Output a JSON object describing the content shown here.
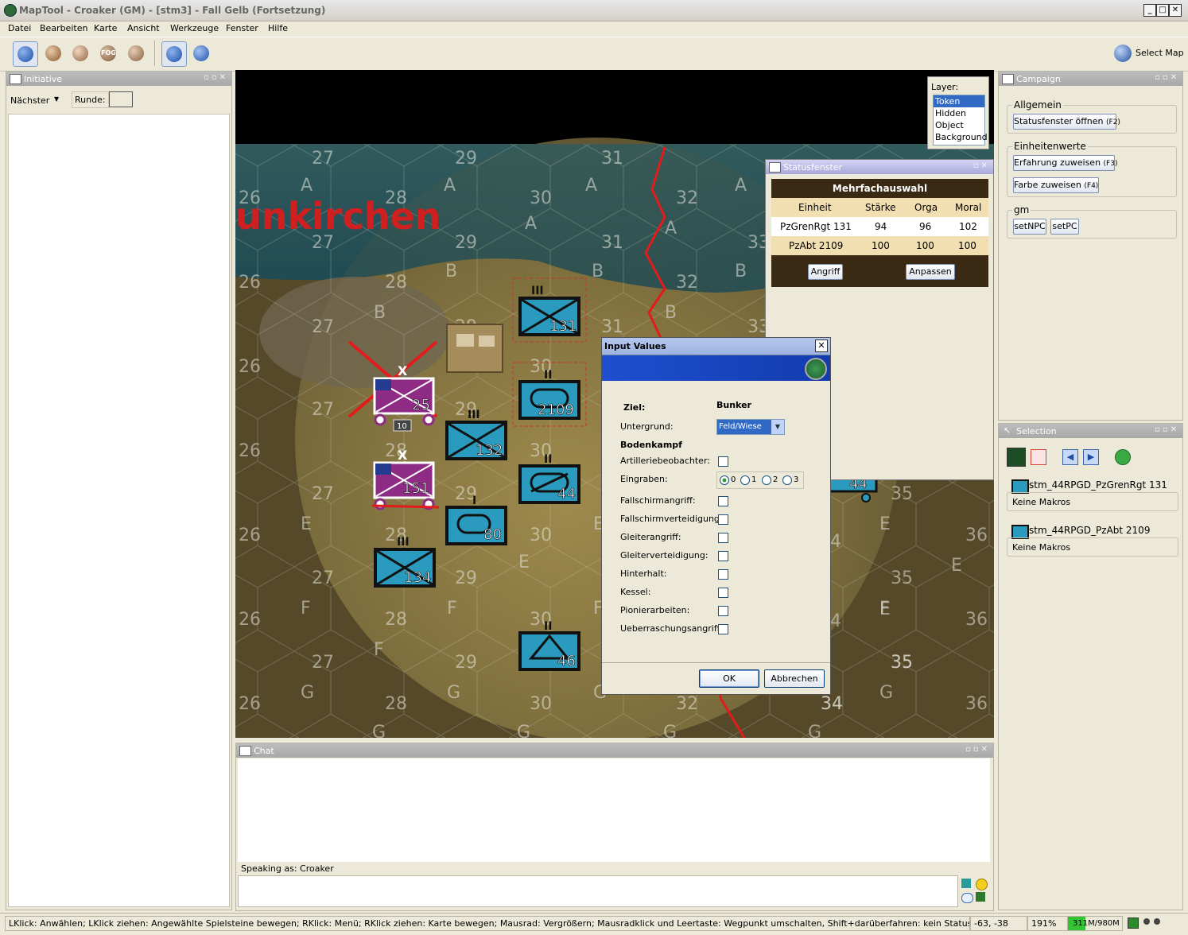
{
  "window": {
    "title": "MapTool - Croaker (GM) - [stm3] - Fall Gelb (Fortsetzung)"
  },
  "menu": [
    "Datei",
    "Bearbeiten",
    "Karte",
    "Ansicht",
    "Werkzeuge",
    "Fenster",
    "Hilfe"
  ],
  "toolbar": {
    "fog_label": "FOG",
    "select_map": "Select Map"
  },
  "initiative": {
    "title": "Initiative",
    "next_label": "Nächster",
    "round_label": "Runde:"
  },
  "map": {
    "city_label": "unkirchen",
    "hex_labels": [
      {
        "t": "27",
        "c": "a"
      },
      {
        "t": "29",
        "c": "b"
      },
      {
        "t": "31",
        "c": "c"
      },
      {
        "t": "A",
        "c": "d"
      },
      {
        "t": "A",
        "c": "e"
      },
      {
        "t": "A",
        "c": "f"
      },
      {
        "t": "26",
        "c": "g"
      },
      {
        "t": "28",
        "c": "h"
      },
      {
        "t": "30",
        "c": "i"
      },
      {
        "t": "32",
        "c": "j"
      },
      {
        "t": "A",
        "c": "k"
      },
      {
        "t": "A",
        "c": "l"
      },
      {
        "t": "A",
        "c": "m"
      },
      {
        "t": "27",
        "c": "n"
      },
      {
        "t": "29",
        "c": "o"
      },
      {
        "t": "31",
        "c": "p"
      },
      {
        "t": "33",
        "c": "q"
      },
      {
        "t": "26",
        "c": "r"
      },
      {
        "t": "28",
        "c": "s"
      },
      {
        "t": "32",
        "c": "t"
      },
      {
        "t": "B",
        "c": "u"
      },
      {
        "t": "B",
        "c": "v"
      },
      {
        "t": "B",
        "c": "w"
      },
      {
        "t": "B",
        "c": "x"
      },
      {
        "t": "27",
        "c": "y"
      },
      {
        "t": "29",
        "c": "z"
      },
      {
        "t": "31",
        "c": "aa"
      },
      {
        "t": "33",
        "c": "ab"
      },
      {
        "t": "B",
        "c": "ac"
      },
      {
        "t": "26",
        "c": "ad"
      },
      {
        "t": "30",
        "c": "ae"
      },
      {
        "t": "27",
        "c": "af"
      },
      {
        "t": "29",
        "c": "ag"
      },
      {
        "t": "26",
        "c": "ah"
      },
      {
        "t": "28",
        "c": "ai"
      },
      {
        "t": "30",
        "c": "aj"
      },
      {
        "t": "35",
        "c": "ak"
      },
      {
        "t": "27",
        "c": "al"
      },
      {
        "t": "29",
        "c": "am"
      },
      {
        "t": "26",
        "c": "an"
      },
      {
        "t": "E",
        "c": "ao"
      },
      {
        "t": "28",
        "c": "ap"
      },
      {
        "t": "30",
        "c": "aq"
      },
      {
        "t": "E",
        "c": "ar"
      },
      {
        "t": "E",
        "c": "as"
      },
      {
        "t": "36",
        "c": "at"
      },
      {
        "t": "E",
        "c": "au"
      },
      {
        "t": "27",
        "c": "av"
      },
      {
        "t": "29",
        "c": "aw"
      },
      {
        "t": "E",
        "c": "ax"
      },
      {
        "t": "35",
        "c": "ay"
      },
      {
        "t": "E",
        "c": "az"
      },
      {
        "t": "26",
        "c": "ba"
      },
      {
        "t": "F",
        "c": "bb"
      },
      {
        "t": "28",
        "c": "bc"
      },
      {
        "t": "F",
        "c": "bd"
      },
      {
        "t": "30",
        "c": "be"
      },
      {
        "t": "F",
        "c": "bf"
      },
      {
        "t": "F",
        "c": "bg"
      },
      {
        "t": "36",
        "c": "bh"
      },
      {
        "t": "27",
        "c": "bi"
      },
      {
        "t": "F",
        "c": "bj"
      },
      {
        "t": "29",
        "c": "bk"
      },
      {
        "t": "35",
        "c": "bl"
      },
      {
        "t": "26",
        "c": "bm"
      },
      {
        "t": "G",
        "c": "bn"
      },
      {
        "t": "28",
        "c": "bo"
      },
      {
        "t": "G",
        "c": "bp"
      },
      {
        "t": "30",
        "c": "bq"
      },
      {
        "t": "G",
        "c": "br"
      },
      {
        "t": "32",
        "c": "bs"
      },
      {
        "t": "34",
        "c": "bt"
      },
      {
        "t": "G",
        "c": "bu"
      },
      {
        "t": "36",
        "c": "bv"
      },
      {
        "t": "G",
        "c": "bw"
      },
      {
        "t": "G",
        "c": "bx"
      },
      {
        "t": "G",
        "c": "by"
      },
      {
        "t": "G",
        "c": "bz"
      },
      {
        "t": "4",
        "c": "ca"
      },
      {
        "t": "4",
        "c": "cb"
      },
      {
        "t": "35",
        "c": "cc"
      },
      {
        "t": "34",
        "c": "cd"
      }
    ],
    "units": [
      {
        "id": "131",
        "echelon": "III",
        "kind": "mech"
      },
      {
        "id": "2109",
        "echelon": "II",
        "kind": "armor"
      },
      {
        "id": "132",
        "echelon": "III",
        "kind": "mech"
      },
      {
        "id": "44",
        "echelon": "II",
        "kind": "mech"
      },
      {
        "id": "80",
        "echelon": "I",
        "kind": "armor"
      },
      {
        "id": "134",
        "echelon": "III",
        "kind": "mech"
      },
      {
        "id": "46",
        "echelon": "II",
        "kind": "mech"
      },
      {
        "id": "25",
        "echelon": "X",
        "kind": "enemy"
      },
      {
        "id": "151",
        "echelon": "X",
        "kind": "enemy"
      },
      {
        "id": "10",
        "echelon": "",
        "kind": "marker"
      },
      {
        "id": "44",
        "echelon": "",
        "kind": "partial"
      }
    ],
    "layers": {
      "title": "Layer:",
      "items": [
        "Token",
        "Hidden",
        "Object",
        "Background"
      ],
      "selected": "Token"
    }
  },
  "statusfenster": {
    "title": "Statusfenster",
    "header": "Mehrfachauswahl",
    "columns": [
      "Einheit",
      "Stärke",
      "Orga",
      "Moral"
    ],
    "rows": [
      [
        "PzGrenRgt 131",
        "94",
        "96",
        "102"
      ],
      [
        "PzAbt 2109",
        "100",
        "100",
        "100"
      ]
    ],
    "attack_button": "Angriff",
    "adjust_button": "Anpassen"
  },
  "dialog": {
    "title": "Input Values",
    "target_label": "Ziel:",
    "target_value": "Bunker",
    "ground_label": "Untergrund:",
    "ground_value": "Feld/Wiese",
    "section": "Bodenkampf",
    "artillery": "Artilleriebeobachter:",
    "dig_in": "Eingraben:",
    "dig_options": [
      "0",
      "1",
      "2",
      "3"
    ],
    "dig_selected": "0",
    "para_attack": "Fallschirmangriff:",
    "para_defense": "Fallschirmverteidigung:",
    "glider_attack": "Gleiterangriff:",
    "glider_defense": "Gleiterverteidigung:",
    "ambush": "Hinterhalt:",
    "pocket": "Kessel:",
    "engineering": "Pionierarbeiten:",
    "surprise": "Ueberraschungsangriff:",
    "ok": "OK",
    "cancel": "Abbrechen"
  },
  "campaign": {
    "title": "Campaign",
    "general_group": "Allgemein",
    "status_btn": "Statusfenster öffnen",
    "status_key": "(F2)",
    "unit_group": "Einheitenwerte",
    "exp_btn": "Erfahrung zuweisen",
    "exp_key": "(F3)",
    "color_btn": "Farbe zuweisen",
    "color_key": "(F4)",
    "gm_group": "gm",
    "set_npc": "setNPC",
    "set_pc": "setPC"
  },
  "selection": {
    "title": "Selection",
    "items": [
      {
        "name": "stm_44RPGD_PzGrenRgt 131",
        "macros": "Keine Makros"
      },
      {
        "name": "stm_44RPGD_PzAbt 2109",
        "macros": "Keine Makros"
      }
    ]
  },
  "chat": {
    "title": "Chat",
    "speaking_as": "Speaking as: Croaker"
  },
  "statusbar": {
    "hint": "LKlick: Anwählen; LKlick ziehen: Angewählte Spielsteine bewegen; RKlick: Menü; RKlick ziehen: Karte bewegen; Mausrad: Vergrößern; Mausradklick und Leertaste: Wegpunkt umschalten, Shift+darüberfahren: kein Statusfeld",
    "coords": "-63, -38",
    "zoom": "191%",
    "memory": "311M/980M",
    "memory_fraction": 0.317
  },
  "colors": {
    "unit_fill": "#2a9bbf",
    "enemy_fill": "#8e2b84",
    "river": "#e31b1b",
    "status_header": "#3a2a14",
    "dialog_banner": "#1b46c7"
  }
}
